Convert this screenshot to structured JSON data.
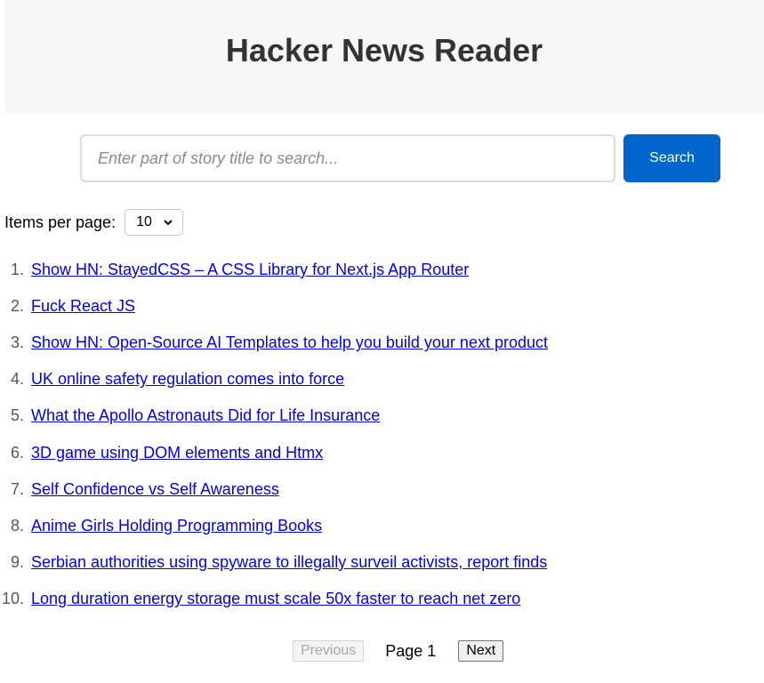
{
  "header": {
    "title": "Hacker News Reader"
  },
  "search": {
    "placeholder": "Enter part of story title to search...",
    "value": "",
    "button_label": "Search"
  },
  "per_page": {
    "label": "Items per page:",
    "selected": "10"
  },
  "stories": [
    {
      "num": "1.",
      "title": "Show HN: StayedCSS – A CSS Library for Next.js App Router"
    },
    {
      "num": "2.",
      "title": "Fuck React JS"
    },
    {
      "num": "3.",
      "title": "Show HN: Open-Source AI Templates to help you build your next product"
    },
    {
      "num": "4.",
      "title": "UK online safety regulation comes into force"
    },
    {
      "num": "5.",
      "title": "What the Apollo Astronauts Did for Life Insurance"
    },
    {
      "num": "6.",
      "title": "3D game using DOM elements and Htmx"
    },
    {
      "num": "7.",
      "title": "Self Confidence vs Self Awareness"
    },
    {
      "num": "8.",
      "title": "Anime Girls Holding Programming Books"
    },
    {
      "num": "9.",
      "title": "Serbian authorities using spyware to illegally surveil activists, report finds"
    },
    {
      "num": "10.",
      "title": "Long duration energy storage must scale 50x faster to reach net zero"
    }
  ],
  "pagination": {
    "previous_label": "Previous",
    "page_label": "Page 1",
    "next_label": "Next"
  },
  "colors": {
    "accent": "#0066cc",
    "link": "#0000ee",
    "header_bg": "#f6f7f9"
  }
}
